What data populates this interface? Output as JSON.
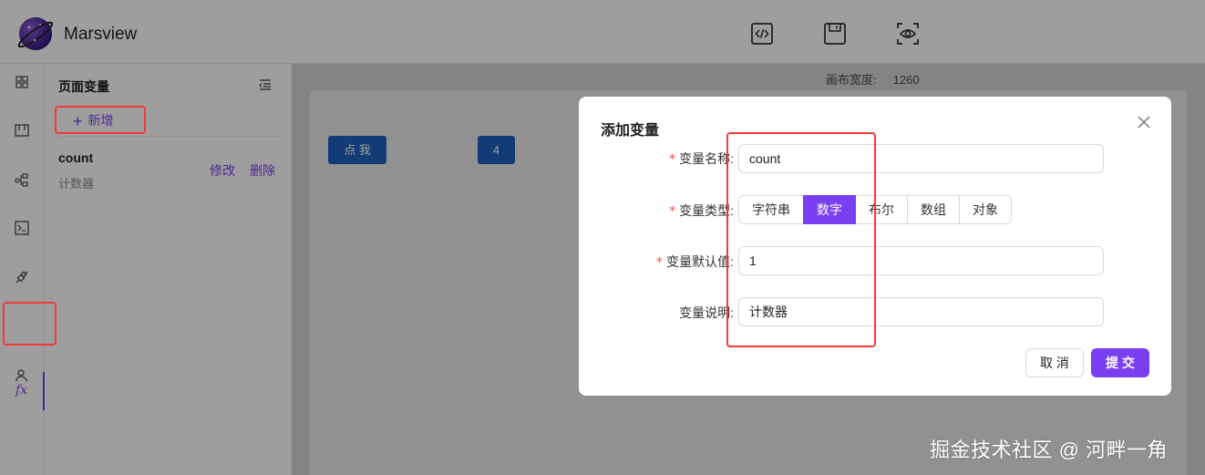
{
  "app": {
    "title": "Marsview"
  },
  "toolbar": {
    "icons": [
      "code-icon",
      "save-icon",
      "preview-icon"
    ]
  },
  "rail": {
    "icons": [
      "grid-icon",
      "layout-icon",
      "tree-icon",
      "console-icon",
      "api-icon",
      "fx-icon",
      "user-icon"
    ],
    "active": "fx",
    "fx_label": "fx"
  },
  "panel": {
    "title": "页面变量",
    "add_label": "新增",
    "add_plus": "+",
    "variables": [
      {
        "name": "count",
        "description": "计数器",
        "edit_label": "修改",
        "delete_label": "删除"
      }
    ]
  },
  "canvas": {
    "width_label": "画布宽度:",
    "width_value": "1260",
    "button_label": "点 我",
    "counter_value": "4"
  },
  "modal": {
    "title": "添加变量",
    "fields": {
      "name": {
        "label": "变量名称",
        "required": true,
        "value": "count"
      },
      "type": {
        "label": "变量类型",
        "required": true,
        "options": [
          "字符串",
          "数字",
          "布尔",
          "数组",
          "对象"
        ],
        "selected": "数字"
      },
      "default": {
        "label": "变量默认值",
        "required": true,
        "value": "1"
      },
      "desc": {
        "label": "变量说明",
        "required": false,
        "value": "计数器"
      }
    },
    "required_mark": "*",
    "label_colon": ":",
    "cancel_label": "取 消",
    "submit_label": "提 交"
  },
  "colors": {
    "accent": "#7b3ff2",
    "canvas_button": "#1f5fbf",
    "highlight": "#f03b3b"
  },
  "watermark": "掘金技术社区 @ 河畔一角"
}
